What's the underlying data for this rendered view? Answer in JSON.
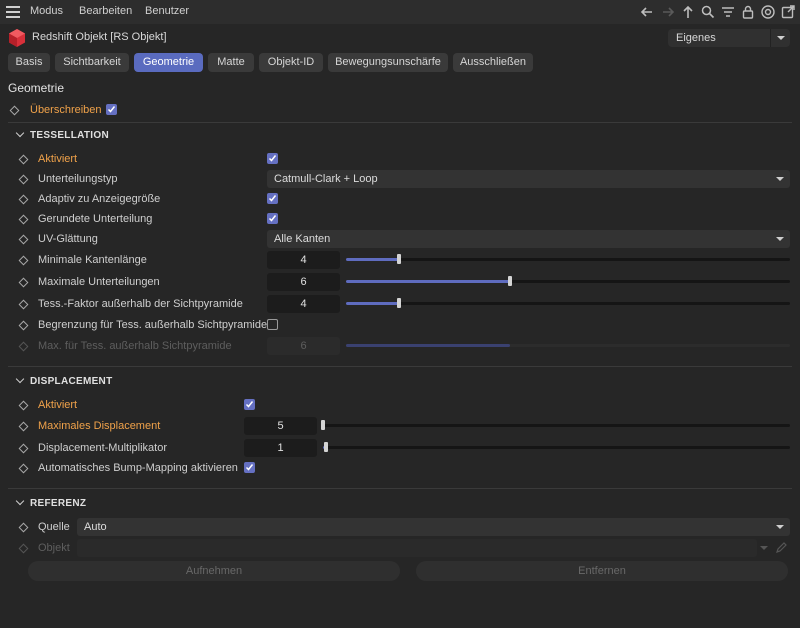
{
  "menubar": {
    "items": [
      "Modus",
      "Bearbeiten",
      "Benutzer"
    ]
  },
  "toolbar": {
    "icons": [
      "arrow-left-icon",
      "arrow-right-icon",
      "arrow-up-icon",
      "search-icon",
      "filter-icon",
      "lock-icon",
      "target-icon",
      "new-window-icon"
    ]
  },
  "object": {
    "title": "Redshift Objekt [RS Objekt]",
    "mode": "Eigenes",
    "icon": "redshift-cube-icon"
  },
  "tabs": [
    "Basis",
    "Sichtbarkeit",
    "Geometrie",
    "Matte",
    "Objekt-ID",
    "Bewegungsunschärfe",
    "Ausschließen"
  ],
  "active_tab": "Geometrie",
  "heading": "Geometrie",
  "override": {
    "label": "Überschreiben",
    "checked": true
  },
  "tessellation": {
    "title": "TESSELLATION",
    "enabled": {
      "label": "Aktiviert",
      "checked": true
    },
    "subdiv_type": {
      "label": "Unterteilungstyp",
      "value": "Catmull-Clark + Loop"
    },
    "adaptive": {
      "label": "Adaptiv zu Anzeigegröße",
      "checked": true
    },
    "rounded": {
      "label": "Gerundete Unterteilung",
      "checked": true
    },
    "uv_smoothing": {
      "label": "UV-Glättung",
      "value": "Alle Kanten"
    },
    "min_edge": {
      "label": "Minimale Kantenlänge",
      "value": "4",
      "level": 0.12
    },
    "max_subdiv": {
      "label": "Maximale Unterteilungen",
      "value": "6",
      "level": 0.37
    },
    "tess_factor": {
      "label": "Tess.-Faktor außerhalb der Sichtpyramide",
      "value": "4",
      "level": 0.12
    },
    "limit": {
      "label": "Begrenzung für Tess. außerhalb Sichtpyramide",
      "checked": false
    },
    "max_outside": {
      "label": "Max. für Tess. außerhalb Sichtpyramide",
      "value": "6",
      "level": 0.37
    }
  },
  "displacement": {
    "title": "DISPLACEMENT",
    "enabled": {
      "label": "Aktiviert",
      "checked": true
    },
    "max": {
      "label": "Maximales Displacement",
      "value": "5",
      "level": 0.0
    },
    "multiplier": {
      "label": "Displacement-Multiplikator",
      "value": "1",
      "level": 0.0
    },
    "auto_bump": {
      "label": "Automatisches Bump-Mapping aktivieren",
      "checked": true
    }
  },
  "reference": {
    "title": "REFERENZ",
    "source": {
      "label": "Quelle",
      "value": "Auto"
    },
    "object": {
      "label": "Objekt",
      "value": ""
    },
    "buttons": {
      "take": "Aufnehmen",
      "remove": "Entfernen"
    }
  },
  "colors": {
    "accent": "#5a6bbf",
    "orange": "#f0a24a",
    "bg": "#262626"
  }
}
